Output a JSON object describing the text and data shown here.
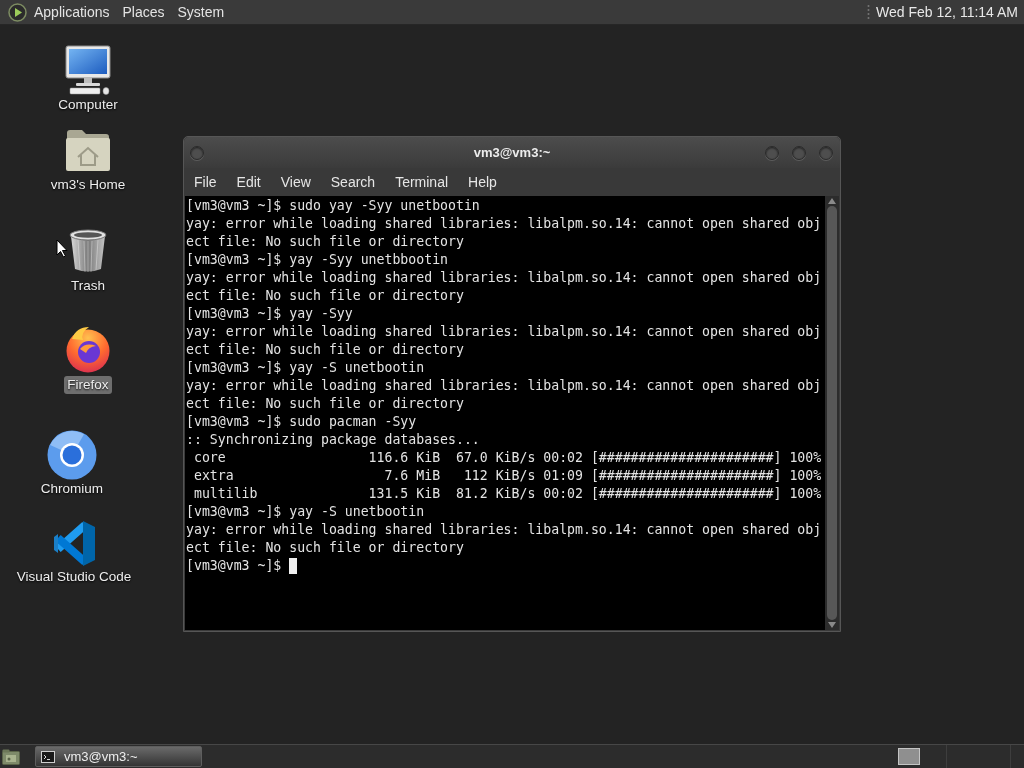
{
  "top_panel": {
    "menus": [
      "Applications",
      "Places",
      "System"
    ],
    "clock": "Wed Feb 12, 11:14 AM"
  },
  "desktop_icons": [
    {
      "label": "Computer",
      "kind": "computer",
      "selected": false
    },
    {
      "label": "vm3's Home",
      "kind": "home",
      "selected": false
    },
    {
      "label": "Trash",
      "kind": "trash",
      "selected": false
    },
    {
      "label": "Firefox",
      "kind": "firefox",
      "selected": true
    },
    {
      "label": "Chromium",
      "kind": "chromium",
      "selected": false
    },
    {
      "label": "Visual Studio Code",
      "kind": "vscode",
      "selected": false
    }
  ],
  "terminal_window": {
    "title": "vm3@vm3:~",
    "menu": [
      "File",
      "Edit",
      "View",
      "Search",
      "Terminal",
      "Help"
    ],
    "lines": [
      "[vm3@vm3 ~]$ sudo yay -Syy unetbootin",
      "yay: error while loading shared libraries: libalpm.so.14: cannot open shared obj",
      "ect file: No such file or directory",
      "[vm3@vm3 ~]$ yay -Syy unetbbootin",
      "yay: error while loading shared libraries: libalpm.so.14: cannot open shared obj",
      "ect file: No such file or directory",
      "[vm3@vm3 ~]$ yay -Syy",
      "yay: error while loading shared libraries: libalpm.so.14: cannot open shared obj",
      "ect file: No such file or directory",
      "[vm3@vm3 ~]$ yay -S unetbootin",
      "yay: error while loading shared libraries: libalpm.so.14: cannot open shared obj",
      "ect file: No such file or directory",
      "[vm3@vm3 ~]$ sudo pacman -Syy",
      ":: Synchronizing package databases...",
      " core                  116.6 KiB  67.0 KiB/s 00:02 [######################] 100%",
      " extra                   7.6 MiB   112 KiB/s 01:09 [######################] 100%",
      " multilib              131.5 KiB  81.2 KiB/s 00:02 [######################] 100%",
      "[vm3@vm3 ~]$ yay -S unetbootin",
      "yay: error while loading shared libraries: libalpm.so.14: cannot open shared obj",
      "ect file: No such file or directory",
      "[vm3@vm3 ~]$"
    ],
    "cursor": true
  },
  "taskbar": {
    "tasks": [
      {
        "label": "vm3@vm3:~",
        "selected": true
      }
    ]
  }
}
